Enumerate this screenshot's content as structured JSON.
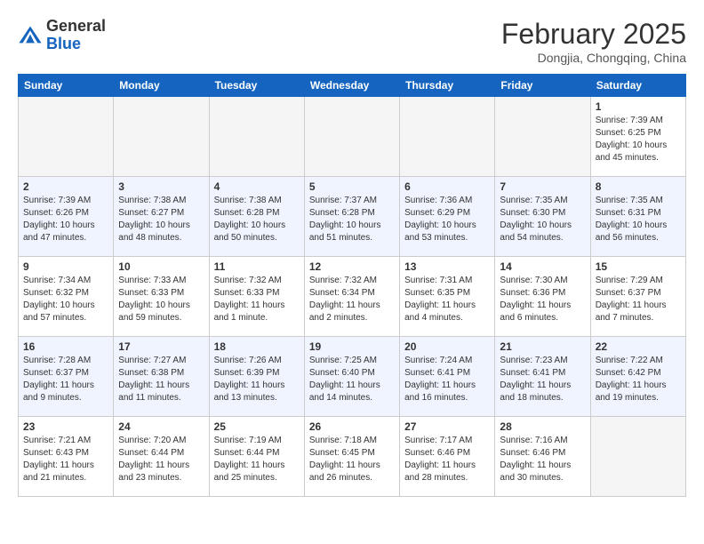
{
  "header": {
    "logo_line1": "General",
    "logo_line2": "Blue",
    "month_year": "February 2025",
    "location": "Dongjia, Chongqing, China"
  },
  "days_of_week": [
    "Sunday",
    "Monday",
    "Tuesday",
    "Wednesday",
    "Thursday",
    "Friday",
    "Saturday"
  ],
  "weeks": [
    [
      {
        "day": "",
        "info": ""
      },
      {
        "day": "",
        "info": ""
      },
      {
        "day": "",
        "info": ""
      },
      {
        "day": "",
        "info": ""
      },
      {
        "day": "",
        "info": ""
      },
      {
        "day": "",
        "info": ""
      },
      {
        "day": "1",
        "info": "Sunrise: 7:39 AM\nSunset: 6:25 PM\nDaylight: 10 hours\nand 45 minutes."
      }
    ],
    [
      {
        "day": "2",
        "info": "Sunrise: 7:39 AM\nSunset: 6:26 PM\nDaylight: 10 hours\nand 47 minutes."
      },
      {
        "day": "3",
        "info": "Sunrise: 7:38 AM\nSunset: 6:27 PM\nDaylight: 10 hours\nand 48 minutes."
      },
      {
        "day": "4",
        "info": "Sunrise: 7:38 AM\nSunset: 6:28 PM\nDaylight: 10 hours\nand 50 minutes."
      },
      {
        "day": "5",
        "info": "Sunrise: 7:37 AM\nSunset: 6:28 PM\nDaylight: 10 hours\nand 51 minutes."
      },
      {
        "day": "6",
        "info": "Sunrise: 7:36 AM\nSunset: 6:29 PM\nDaylight: 10 hours\nand 53 minutes."
      },
      {
        "day": "7",
        "info": "Sunrise: 7:35 AM\nSunset: 6:30 PM\nDaylight: 10 hours\nand 54 minutes."
      },
      {
        "day": "8",
        "info": "Sunrise: 7:35 AM\nSunset: 6:31 PM\nDaylight: 10 hours\nand 56 minutes."
      }
    ],
    [
      {
        "day": "9",
        "info": "Sunrise: 7:34 AM\nSunset: 6:32 PM\nDaylight: 10 hours\nand 57 minutes."
      },
      {
        "day": "10",
        "info": "Sunrise: 7:33 AM\nSunset: 6:33 PM\nDaylight: 10 hours\nand 59 minutes."
      },
      {
        "day": "11",
        "info": "Sunrise: 7:32 AM\nSunset: 6:33 PM\nDaylight: 11 hours\nand 1 minute."
      },
      {
        "day": "12",
        "info": "Sunrise: 7:32 AM\nSunset: 6:34 PM\nDaylight: 11 hours\nand 2 minutes."
      },
      {
        "day": "13",
        "info": "Sunrise: 7:31 AM\nSunset: 6:35 PM\nDaylight: 11 hours\nand 4 minutes."
      },
      {
        "day": "14",
        "info": "Sunrise: 7:30 AM\nSunset: 6:36 PM\nDaylight: 11 hours\nand 6 minutes."
      },
      {
        "day": "15",
        "info": "Sunrise: 7:29 AM\nSunset: 6:37 PM\nDaylight: 11 hours\nand 7 minutes."
      }
    ],
    [
      {
        "day": "16",
        "info": "Sunrise: 7:28 AM\nSunset: 6:37 PM\nDaylight: 11 hours\nand 9 minutes."
      },
      {
        "day": "17",
        "info": "Sunrise: 7:27 AM\nSunset: 6:38 PM\nDaylight: 11 hours\nand 11 minutes."
      },
      {
        "day": "18",
        "info": "Sunrise: 7:26 AM\nSunset: 6:39 PM\nDaylight: 11 hours\nand 13 minutes."
      },
      {
        "day": "19",
        "info": "Sunrise: 7:25 AM\nSunset: 6:40 PM\nDaylight: 11 hours\nand 14 minutes."
      },
      {
        "day": "20",
        "info": "Sunrise: 7:24 AM\nSunset: 6:41 PM\nDaylight: 11 hours\nand 16 minutes."
      },
      {
        "day": "21",
        "info": "Sunrise: 7:23 AM\nSunset: 6:41 PM\nDaylight: 11 hours\nand 18 minutes."
      },
      {
        "day": "22",
        "info": "Sunrise: 7:22 AM\nSunset: 6:42 PM\nDaylight: 11 hours\nand 19 minutes."
      }
    ],
    [
      {
        "day": "23",
        "info": "Sunrise: 7:21 AM\nSunset: 6:43 PM\nDaylight: 11 hours\nand 21 minutes."
      },
      {
        "day": "24",
        "info": "Sunrise: 7:20 AM\nSunset: 6:44 PM\nDaylight: 11 hours\nand 23 minutes."
      },
      {
        "day": "25",
        "info": "Sunrise: 7:19 AM\nSunset: 6:44 PM\nDaylight: 11 hours\nand 25 minutes."
      },
      {
        "day": "26",
        "info": "Sunrise: 7:18 AM\nSunset: 6:45 PM\nDaylight: 11 hours\nand 26 minutes."
      },
      {
        "day": "27",
        "info": "Sunrise: 7:17 AM\nSunset: 6:46 PM\nDaylight: 11 hours\nand 28 minutes."
      },
      {
        "day": "28",
        "info": "Sunrise: 7:16 AM\nSunset: 6:46 PM\nDaylight: 11 hours\nand 30 minutes."
      },
      {
        "day": "",
        "info": ""
      }
    ]
  ]
}
